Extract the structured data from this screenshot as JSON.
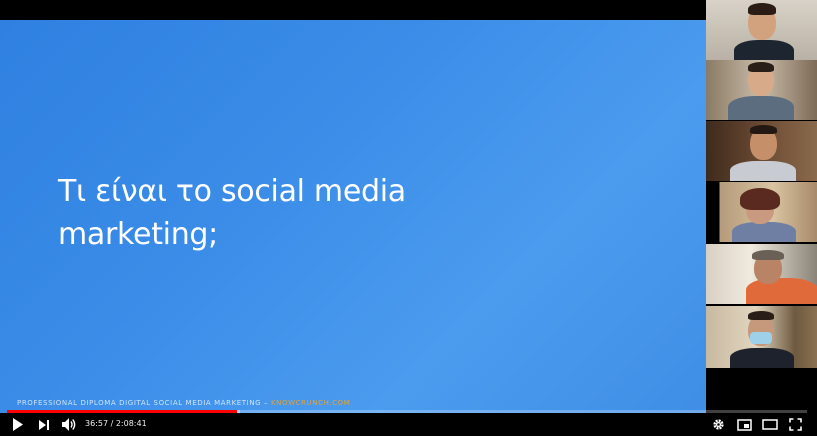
{
  "slide": {
    "title_line1": "Τι είναι το social media",
    "title_line2": "marketing;",
    "footer_text": "PROFESSIONAL DIPLOMA DIGITAL SOCIAL MEDIA MARKETING – ",
    "footer_brand": "KNOWCRUNCH.COM",
    "background_color": "#3b8de8"
  },
  "participants": [
    {
      "id": "p1"
    },
    {
      "id": "p2"
    },
    {
      "id": "p3"
    },
    {
      "id": "p4"
    },
    {
      "id": "p5"
    },
    {
      "id": "p6"
    }
  ],
  "player": {
    "current_time": "36:57",
    "separator": " / ",
    "duration": "2:08:41",
    "progress_fraction": 0.288,
    "accent_color": "#ff0000"
  },
  "icons": [
    "play-icon",
    "next-icon",
    "volume-icon",
    "settings-icon",
    "miniplayer-icon",
    "theater-icon",
    "fullscreen-icon"
  ]
}
